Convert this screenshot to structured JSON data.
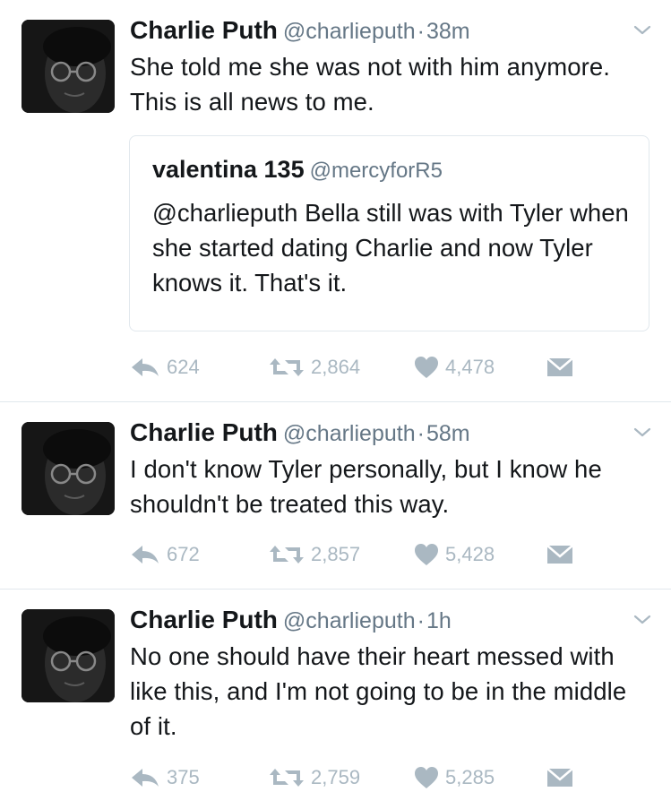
{
  "tweets": [
    {
      "name": "Charlie Puth",
      "handle": "@charlieputh",
      "separator": "·",
      "time": "38m",
      "text": "She told me she was not with him anymore. This is all news to me.",
      "quote": {
        "name": "valentina 135",
        "handle": "@mercyforR5",
        "text": "@charlieputh Bella still was with Tyler when she started dating Charlie and now Tyler knows it. That's it."
      },
      "replies": "624",
      "retweets": "2,864",
      "likes": "4,478"
    },
    {
      "name": "Charlie Puth",
      "handle": "@charlieputh",
      "separator": "·",
      "time": "58m",
      "text": "I don't know Tyler personally, but I know he shouldn't be treated this way.",
      "replies": "672",
      "retweets": "2,857",
      "likes": "5,428"
    },
    {
      "name": "Charlie Puth",
      "handle": "@charlieputh",
      "separator": "·",
      "time": "1h",
      "text": "No one should have their heart messed with like this, and I'm not going to be in the middle of it.",
      "replies": "375",
      "retweets": "2,759",
      "likes": "5,285"
    }
  ],
  "icons": {
    "reply": "reply-icon",
    "retweet": "retweet-icon",
    "like": "heart-icon",
    "dm": "envelope-icon",
    "more": "chevron-down-icon"
  },
  "colors": {
    "text": "#14171a",
    "secondary": "#657786",
    "action": "#aab8c2",
    "border": "#e1e8ed"
  }
}
